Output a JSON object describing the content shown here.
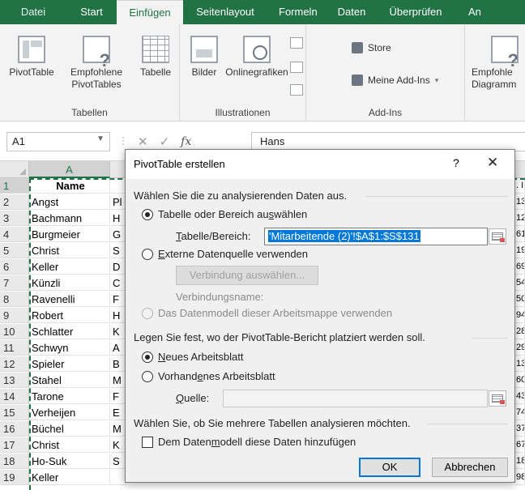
{
  "ribbon": {
    "tabs": [
      "Datei",
      "Start",
      "Einfügen",
      "Seitenlayout",
      "Formeln",
      "Daten",
      "Überprüfen",
      "An"
    ],
    "active_tab": "Einfügen",
    "groups": {
      "tabellen": {
        "label": "Tabellen",
        "pivottable": "PivotTable",
        "recommended_line1": "Empfohlene",
        "recommended_line2": "PivotTables",
        "tabelle": "Tabelle"
      },
      "illustrationen": {
        "label": "Illustrationen",
        "bilder": "Bilder",
        "onlinegrafiken": "Onlinegrafiken"
      },
      "addins": {
        "label": "Add-Ins",
        "store": "Store",
        "meine": "Meine Add-Ins"
      },
      "charts": {
        "label_line1": "Empfohle",
        "label_line2": "Diagramm"
      }
    }
  },
  "formula_bar": {
    "name_box": "A1",
    "fx": "fx",
    "value": "Hans"
  },
  "grid": {
    "columns": [
      "A"
    ],
    "col_a_header": "Name",
    "rows": [
      {
        "n": "1",
        "a": "Name",
        "b": "",
        "r": ". I"
      },
      {
        "n": "2",
        "a": "Angst",
        "b": "Pl",
        "r": "13"
      },
      {
        "n": "3",
        "a": "Bachmann",
        "b": "H",
        "r": "12"
      },
      {
        "n": "4",
        "a": "Burgmeier",
        "b": "G",
        "r": "61"
      },
      {
        "n": "5",
        "a": "Christ",
        "b": "S",
        "r": "19"
      },
      {
        "n": "6",
        "a": "Keller",
        "b": "D",
        "r": "69"
      },
      {
        "n": "7",
        "a": "Künzli",
        "b": "C",
        "r": "54"
      },
      {
        "n": "8",
        "a": "Ravenelli",
        "b": "F",
        "r": "50"
      },
      {
        "n": "9",
        "a": "Robert",
        "b": "H",
        "r": "94"
      },
      {
        "n": "10",
        "a": "Schlatter",
        "b": "K",
        "r": "28"
      },
      {
        "n": "11",
        "a": "Schwyn",
        "b": "A",
        "r": "29"
      },
      {
        "n": "12",
        "a": "Spieler",
        "b": "B",
        "r": "13"
      },
      {
        "n": "13",
        "a": "Stahel",
        "b": "M",
        "r": "60"
      },
      {
        "n": "14",
        "a": "Tarone",
        "b": "F",
        "r": "43"
      },
      {
        "n": "15",
        "a": "Verheijen",
        "b": "E",
        "r": "74"
      },
      {
        "n": "16",
        "a": "Büchel",
        "b": "M",
        "r": "37"
      },
      {
        "n": "17",
        "a": "Christ",
        "b": "K",
        "r": "67"
      },
      {
        "n": "18",
        "a": "Ho-Suk",
        "b": "S",
        "r": "18"
      },
      {
        "n": "19",
        "a": "Keller",
        "b": "",
        "r": "98"
      }
    ]
  },
  "dialog": {
    "title": "PivotTable erstellen",
    "help": "?",
    "close": "✕",
    "section1": "Wählen Sie die zu analysierenden Daten aus.",
    "opt_range": "Tabelle oder Bereich auswählen",
    "range_label": "Tabelle/Bereich:",
    "range_value": "'Mitarbeitende (2)'!$A$1:$S$131",
    "opt_external": "Externe Datenquelle verwenden",
    "btn_connection": "Verbindung auswählen...",
    "connection_name": "Verbindungsname:",
    "opt_datamodel": "Das Datenmodell dieser Arbeitsmappe verwenden",
    "section2": "Legen Sie fest, wo der PivotTable-Bericht platziert werden soll.",
    "opt_new_sheet": "Neues Arbeitsblatt",
    "opt_existing_sheet": "Vorhandenes Arbeitsblatt",
    "source_label": "Quelle:",
    "source_value": "",
    "section3": "Wählen Sie, ob Sie mehrere Tabellen analysieren möchten.",
    "chk_datamodel": "Dem Datenmodell diese Daten hinzufügen",
    "ok": "OK",
    "cancel": "Abbrechen"
  },
  "colors": {
    "excel_green": "#217346",
    "selection_blue": "#0078d7"
  }
}
